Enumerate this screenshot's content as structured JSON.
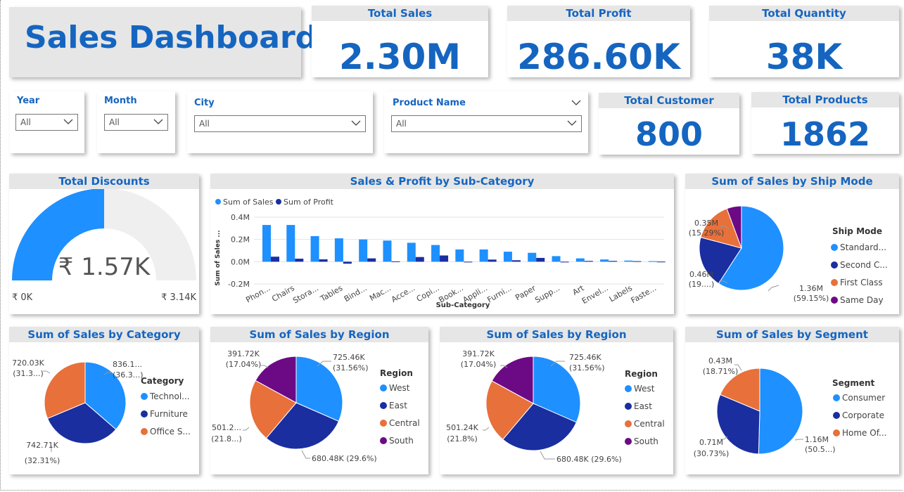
{
  "title": "Sales Dashboard",
  "kpis": {
    "total_sales": {
      "label": "Total Sales",
      "value": "2.30M"
    },
    "total_profit": {
      "label": "Total Profit",
      "value": "286.60K"
    },
    "total_quantity": {
      "label": "Total Quantity",
      "value": "38K"
    },
    "total_customer": {
      "label": "Total Customer",
      "value": "800"
    },
    "total_products": {
      "label": "Total Products",
      "value": "1862"
    }
  },
  "slicers": {
    "year": {
      "label": "Year",
      "value": "All"
    },
    "month": {
      "label": "Month",
      "value": "All"
    },
    "city": {
      "label": "City",
      "value": "All"
    },
    "product": {
      "label": "Product Name",
      "value": "All"
    }
  },
  "colors": {
    "accent": "#1565c0",
    "series_light": "#1e90ff",
    "series_dark": "#1a2ea0",
    "orange": "#e8703a",
    "purple": "#6c0a86",
    "gauge_track": "#efefef",
    "header_bg": "#e6e6e6"
  },
  "discounts": {
    "title": "Total Discounts",
    "value_text": "₹ 1.57K",
    "min_text": "₹ 0K",
    "max_text": "₹ 3.14K",
    "value": 1.57,
    "max": 3.14
  },
  "subcat_chart": {
    "title": "Sales & Profit by Sub-Category",
    "legend": [
      "Sum of Sales",
      "Sum of Profit"
    ],
    "xlabel": "Sub-Category",
    "ylabel": "Sum of Sales ...",
    "ticks": [
      "0.4M",
      "0.2M",
      "0.0M",
      "-0.2M"
    ]
  },
  "shipmode_chart": {
    "title": "Sum of Sales by Ship Mode",
    "legend_title": "Ship Mode",
    "legend": [
      "Standard...",
      "Second C...",
      "First Class",
      "Same Day"
    ],
    "labels": [
      {
        "l1": "1.36M",
        "l2": "(59.15%)"
      },
      {
        "l1": "0.46M",
        "l2": "(19....)"
      },
      {
        "l1": "0.35M",
        "l2": "(15.29%)"
      }
    ]
  },
  "category_chart": {
    "title": "Sum of Sales by Category",
    "legend_title": "Category",
    "legend": [
      "Technol...",
      "Furniture",
      "Office S..."
    ],
    "labels": [
      {
        "l1": "836.1...",
        "l2": "(36.3...)"
      },
      {
        "l1": "742.71K",
        "l2": "(32.31%)"
      },
      {
        "l1": "720.03K",
        "l2": "(31.3...)"
      }
    ]
  },
  "region_chart_1": {
    "title": "Sum of Sales by Region",
    "legend_title": "Region",
    "legend": [
      "West",
      "East",
      "Central",
      "South"
    ],
    "labels": [
      {
        "l1": "725.46K",
        "l2": "(31.56%)"
      },
      {
        "l1": "680.48K (29.6%)",
        "l2": ""
      },
      {
        "l1": "501.2...",
        "l2": "(21.8...)"
      },
      {
        "l1": "391.72K",
        "l2": "(17.04%)"
      }
    ]
  },
  "region_chart_2": {
    "title": "Sum of Sales by Region",
    "legend_title": "Region",
    "legend": [
      "West",
      "East",
      "Central",
      "South"
    ],
    "labels": [
      {
        "l1": "725.46K",
        "l2": "(31.56%)"
      },
      {
        "l1": "680.48K (29.6%)",
        "l2": ""
      },
      {
        "l1": "501.24K",
        "l2": "(21.8%)"
      },
      {
        "l1": "391.72K",
        "l2": "(17.04%)"
      }
    ]
  },
  "segment_chart": {
    "title": "Sum of Sales by Segment",
    "legend_title": "Segment",
    "legend": [
      "Consumer",
      "Corporate",
      "Home Of..."
    ],
    "labels": [
      {
        "l1": "1.16M",
        "l2": "(50.5...)"
      },
      {
        "l1": "0.71M",
        "l2": "(30.73%)"
      },
      {
        "l1": "0.43M",
        "l2": "(18.71%)"
      }
    ]
  },
  "chart_data": [
    {
      "type": "bar",
      "title": "Sales & Profit by Sub-Category",
      "xlabel": "Sub-Category",
      "ylabel": "Sum of Sales ...",
      "categories": [
        "Phon...",
        "Chairs",
        "Stora...",
        "Tables",
        "Bind...",
        "Mac...",
        "Acce...",
        "Copi...",
        "Book...",
        "Appli...",
        "Furni...",
        "Paper",
        "Supp...",
        "Art",
        "Envel...",
        "Labels",
        "Faste..."
      ],
      "series": [
        {
          "name": "Sum of Sales",
          "values": [
            0.33,
            0.33,
            0.23,
            0.21,
            0.2,
            0.19,
            0.17,
            0.15,
            0.11,
            0.11,
            0.09,
            0.08,
            0.05,
            0.03,
            0.02,
            0.01,
            0.005
          ]
        },
        {
          "name": "Sum of Profit",
          "values": [
            0.045,
            0.027,
            0.021,
            -0.018,
            0.03,
            0.003,
            0.042,
            0.056,
            -0.003,
            0.019,
            0.013,
            0.034,
            -0.001,
            0.007,
            0.007,
            0.005,
            0.001
          ]
        }
      ],
      "ylim": [
        -0.2,
        0.4
      ],
      "grid": true,
      "legend": "top-left"
    },
    {
      "type": "pie",
      "title": "Sum of Sales by Ship Mode",
      "categories": [
        "Standard...",
        "Second C...",
        "First Class",
        "Same Day"
      ],
      "values": [
        1.36,
        0.46,
        0.35,
        0.13
      ],
      "legend": "right"
    },
    {
      "type": "pie",
      "title": "Sum of Sales by Category",
      "categories": [
        "Technol...",
        "Furniture",
        "Office S..."
      ],
      "values": [
        836.1,
        742.71,
        720.03
      ],
      "legend": "right"
    },
    {
      "type": "pie",
      "title": "Sum of Sales by Region",
      "categories": [
        "West",
        "East",
        "Central",
        "South"
      ],
      "values": [
        725.46,
        680.48,
        501.24,
        391.72
      ],
      "legend": "right"
    },
    {
      "type": "pie",
      "title": "Sum of Sales by Region",
      "categories": [
        "West",
        "East",
        "Central",
        "South"
      ],
      "values": [
        725.46,
        680.48,
        501.24,
        391.72
      ],
      "legend": "right"
    },
    {
      "type": "pie",
      "title": "Sum of Sales by Segment",
      "categories": [
        "Consumer",
        "Corporate",
        "Home Of..."
      ],
      "values": [
        1.16,
        0.71,
        0.43
      ],
      "legend": "right"
    }
  ]
}
